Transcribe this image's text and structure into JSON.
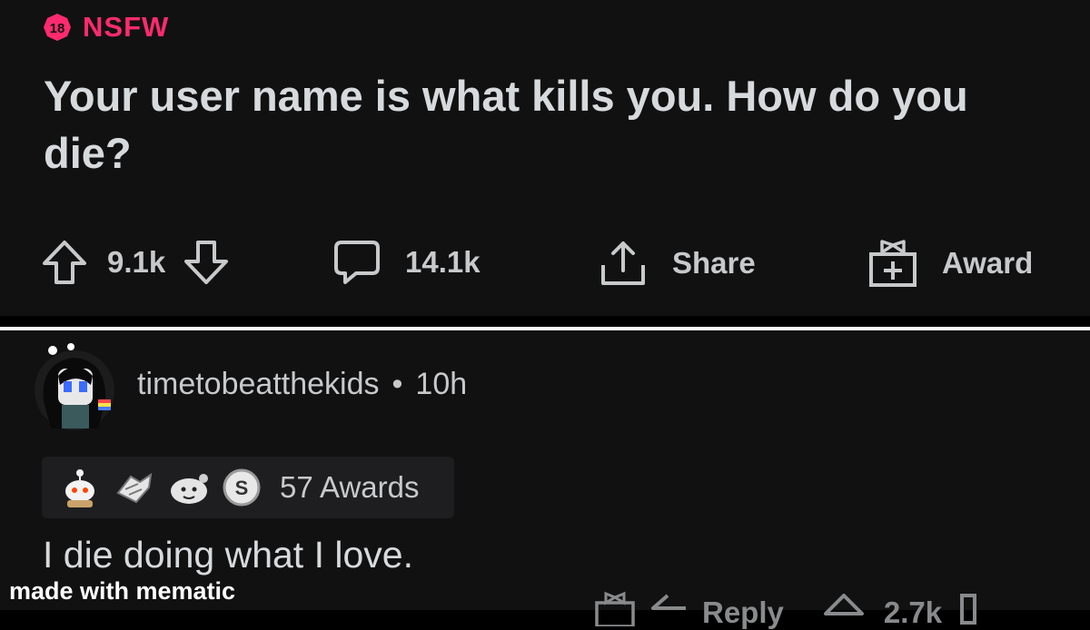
{
  "post": {
    "nsfw_badge": "18",
    "nsfw_label": "NSFW",
    "title": "Your user name is what kills you. How do you die?",
    "upvotes": "9.1k",
    "comments": "14.1k",
    "share_label": "Share",
    "award_label": "Award"
  },
  "comment": {
    "author": "timetobeatthekids",
    "separator": "•",
    "age": "10h",
    "awards_count": "57 Awards",
    "body": "I die doing what I love.",
    "reply_label": "Reply",
    "upvotes": "2.7k"
  },
  "watermark": "made with mematic",
  "colors": {
    "background": "#111112",
    "nsfw": "#ff2b6e",
    "text": "#d7dadc",
    "muted": "#c7c9cb"
  },
  "icons": [
    "nsfw-18-icon",
    "upvote-icon",
    "downvote-icon",
    "comment-icon",
    "share-icon",
    "award-icon",
    "reddit-gold-award-icon",
    "wholesome-award-icon",
    "helpful-award-icon",
    "silver-award-icon"
  ]
}
